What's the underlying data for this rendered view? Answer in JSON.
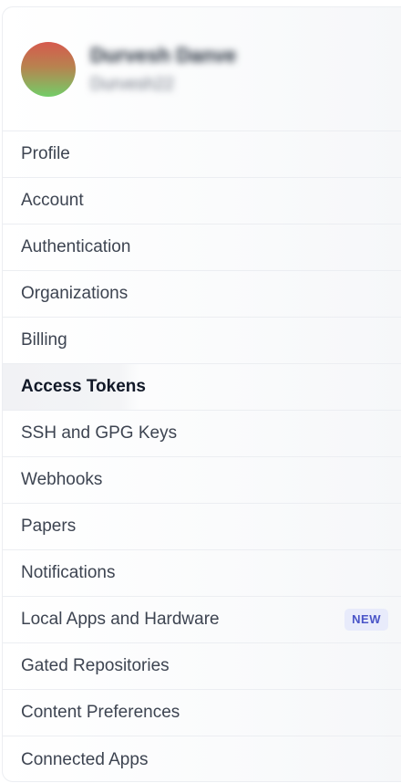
{
  "user": {
    "display_name": "Durvesh Danve",
    "username": "Durvesh22"
  },
  "nav": {
    "items": [
      {
        "label": "Profile"
      },
      {
        "label": "Account"
      },
      {
        "label": "Authentication"
      },
      {
        "label": "Organizations"
      },
      {
        "label": "Billing"
      },
      {
        "label": "Access Tokens",
        "active": true
      },
      {
        "label": "SSH and GPG Keys"
      },
      {
        "label": "Webhooks"
      },
      {
        "label": "Papers"
      },
      {
        "label": "Notifications"
      },
      {
        "label": "Local Apps and Hardware",
        "badge": "NEW"
      },
      {
        "label": "Gated Repositories"
      },
      {
        "label": "Content Preferences"
      },
      {
        "label": "Connected Apps"
      }
    ]
  },
  "colors": {
    "badge_background": "#e8ebfb",
    "badge_text": "#4a55c8",
    "active_background": "#f3f4f6"
  }
}
